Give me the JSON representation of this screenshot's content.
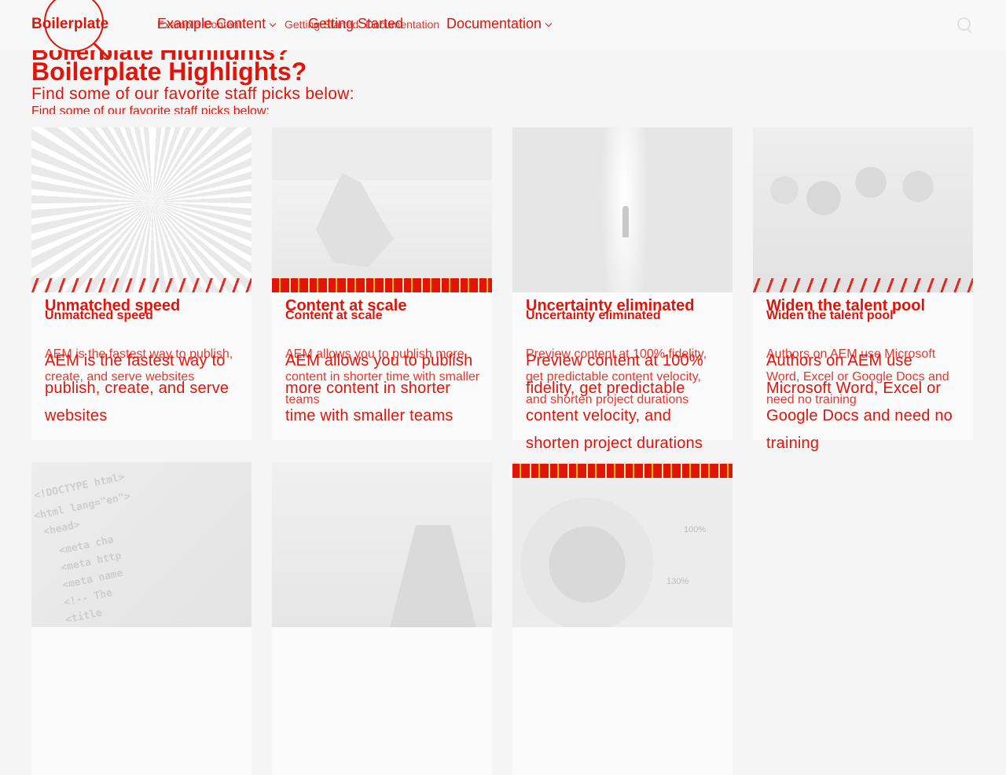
{
  "brand": {
    "name": "Boilerplate"
  },
  "nav": {
    "ghost_items": [
      "Example Content",
      "Getting Started",
      "Documentation"
    ],
    "items": [
      {
        "label": "Example Content"
      },
      {
        "label": "Getting Started"
      },
      {
        "label": "Documentation"
      }
    ]
  },
  "hero": {
    "title": "Boilerplate Highlights?",
    "subtitle": "Find some of our favorite staff picks below:"
  },
  "cards": [
    {
      "image": "light-speed-tunnel",
      "title": "Unmatched speed",
      "text": "AEM is the fastest way to publish, create, and serve websites"
    },
    {
      "image": "iceberg",
      "title": "Content at scale",
      "text": "AEM allows you to publish more content in shorter time with smaller teams"
    },
    {
      "image": "light-door",
      "title": "Uncertainty eliminated",
      "text": "Preview content at 100% fidelity, get predictable content velocity, and shorten project durations"
    },
    {
      "image": "team-meeting",
      "title": "Widen the talent pool",
      "text": "Authors on AEM use Microsoft Word, Excel or Google Docs and need no training"
    },
    {
      "image": "html-code",
      "title": "",
      "text": ""
    },
    {
      "image": "rocket-businessman",
      "title": "",
      "text": ""
    },
    {
      "image": "speed-gauge",
      "title": "",
      "text": ""
    }
  ],
  "code_lines": [
    "<!DOCTYPE html>",
    "<html lang=\"en\">",
    "<head>",
    "<meta cha",
    "<meta http",
    "<meta name",
    "<!-- The",
    "<title"
  ],
  "gauge_labels": [
    "100%",
    "130%"
  ],
  "colors": {
    "accent": "#e1140a",
    "background": "#f5f5f5"
  },
  "icons": {
    "search": "search-icon",
    "brand": "brand-circle-icon"
  }
}
